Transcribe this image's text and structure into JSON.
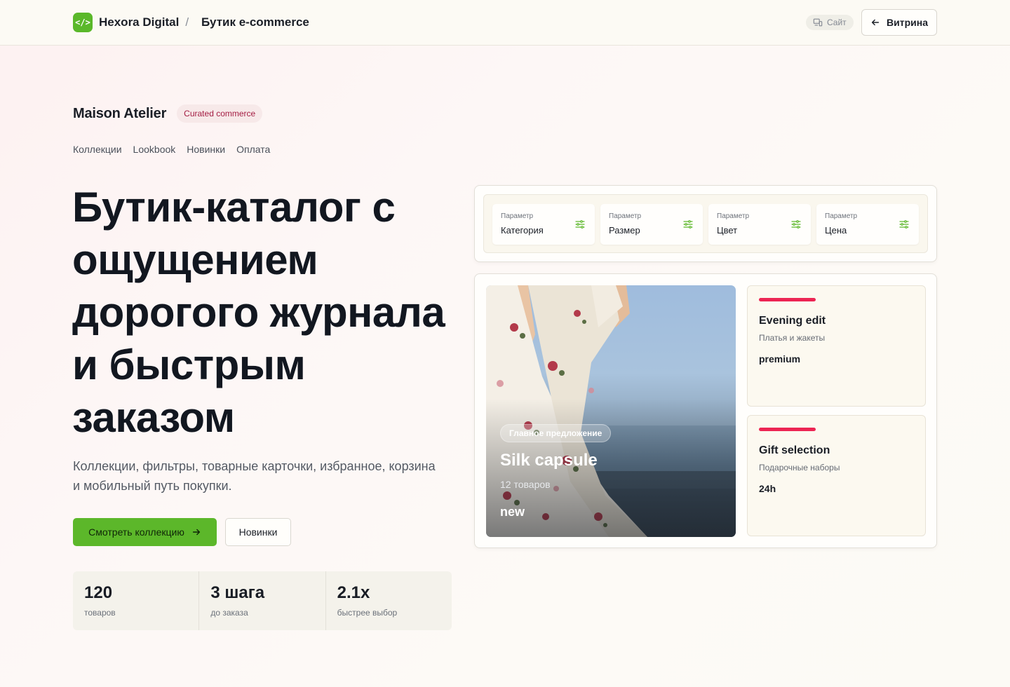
{
  "colors": {
    "accent_green": "#5cb72a",
    "accent_pink": "#ec2553",
    "badge_text": "#a41d43"
  },
  "topbar": {
    "logo_glyph": "</>",
    "brand": "Hexora Digital",
    "separator": "/",
    "project": "Бутик e-commerce",
    "site_chip_icon": "devices-icon",
    "site_chip_label": "Сайт",
    "showcase_icon": "arrow-left-icon",
    "showcase_label": "Витрина"
  },
  "store": {
    "name": "Maison Atelier",
    "badge": "Curated commerce"
  },
  "nav": {
    "items": [
      "Коллекции",
      "Lookbook",
      "Новинки",
      "Оплата"
    ]
  },
  "hero": {
    "title": "Бутик-каталог с ощущением дорогого журнала и быстрым заказом",
    "subtitle": "Коллекции, фильтры, товарные карточки, избранное, корзина и мобильный путь покупки.",
    "primary_cta": "Смотреть коллекцию",
    "primary_cta_icon": "arrow-right-icon",
    "secondary_cta": "Новинки"
  },
  "stats": [
    {
      "value": "120",
      "label": "товаров"
    },
    {
      "value": "3 шага",
      "label": "до заказа"
    },
    {
      "value": "2.1x",
      "label": "быстрее выбор"
    }
  ],
  "filters": {
    "icon": "sliders-icon",
    "items": [
      {
        "label": "Параметр",
        "value": "Категория"
      },
      {
        "label": "Параметр",
        "value": "Размер"
      },
      {
        "label": "Параметр",
        "value": "Цвет"
      },
      {
        "label": "Параметр",
        "value": "Цена"
      }
    ]
  },
  "feature": {
    "chip": "Главное предложение",
    "title": "Silk capsule",
    "count": "12 товаров",
    "tag": "new"
  },
  "side_cards": [
    {
      "title": "Evening edit",
      "subtitle": "Платья и жакеты",
      "tag": "premium"
    },
    {
      "title": "Gift selection",
      "subtitle": "Подарочные наборы",
      "tag": "24h"
    }
  ]
}
